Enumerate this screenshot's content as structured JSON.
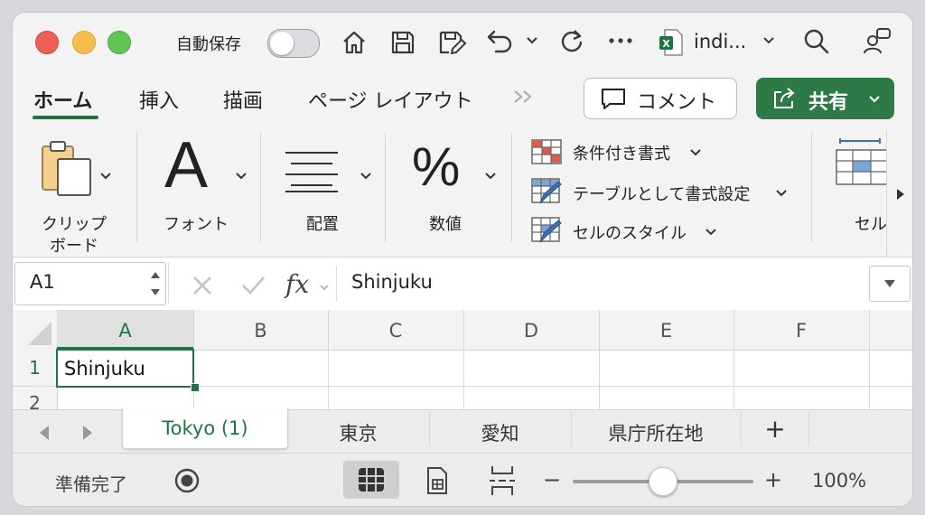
{
  "titlebar": {
    "autosave_label": "自動保存",
    "file_name": "indi..."
  },
  "tabs": [
    {
      "label": "ホーム"
    },
    {
      "label": "挿入"
    },
    {
      "label": "描画"
    },
    {
      "label": "ページ レイアウト"
    }
  ],
  "buttons": {
    "comment": "コメント",
    "share": "共有"
  },
  "ribbon": {
    "clipboard_line1": "クリップ",
    "clipboard_line2": "ボード",
    "font": "フォント",
    "alignment": "配置",
    "number": "数値",
    "conditional_formatting": "条件付き書式",
    "format_as_table": "テーブルとして書式設定",
    "cell_styles": "セルのスタイル",
    "cells": "セル"
  },
  "formula_bar": {
    "name_box": "A1",
    "fx": "fx",
    "value": "Shinjuku"
  },
  "grid": {
    "columns": [
      "A",
      "B",
      "C",
      "D",
      "E",
      "F"
    ],
    "rows": [
      "1",
      "2"
    ],
    "a1": "Shinjuku"
  },
  "sheets": [
    {
      "label": "Tokyo (1)"
    },
    {
      "label": "東京"
    },
    {
      "label": "愛知"
    },
    {
      "label": "県庁所在地"
    }
  ],
  "add_sheet": "+",
  "status": {
    "ready": "準備完了",
    "zoom_minus": "−",
    "zoom_plus": "+",
    "zoom": "100%",
    "zoom_level": 0.5
  },
  "colors": {
    "accent_green": "#217346",
    "share_green": "#2d7a46"
  }
}
